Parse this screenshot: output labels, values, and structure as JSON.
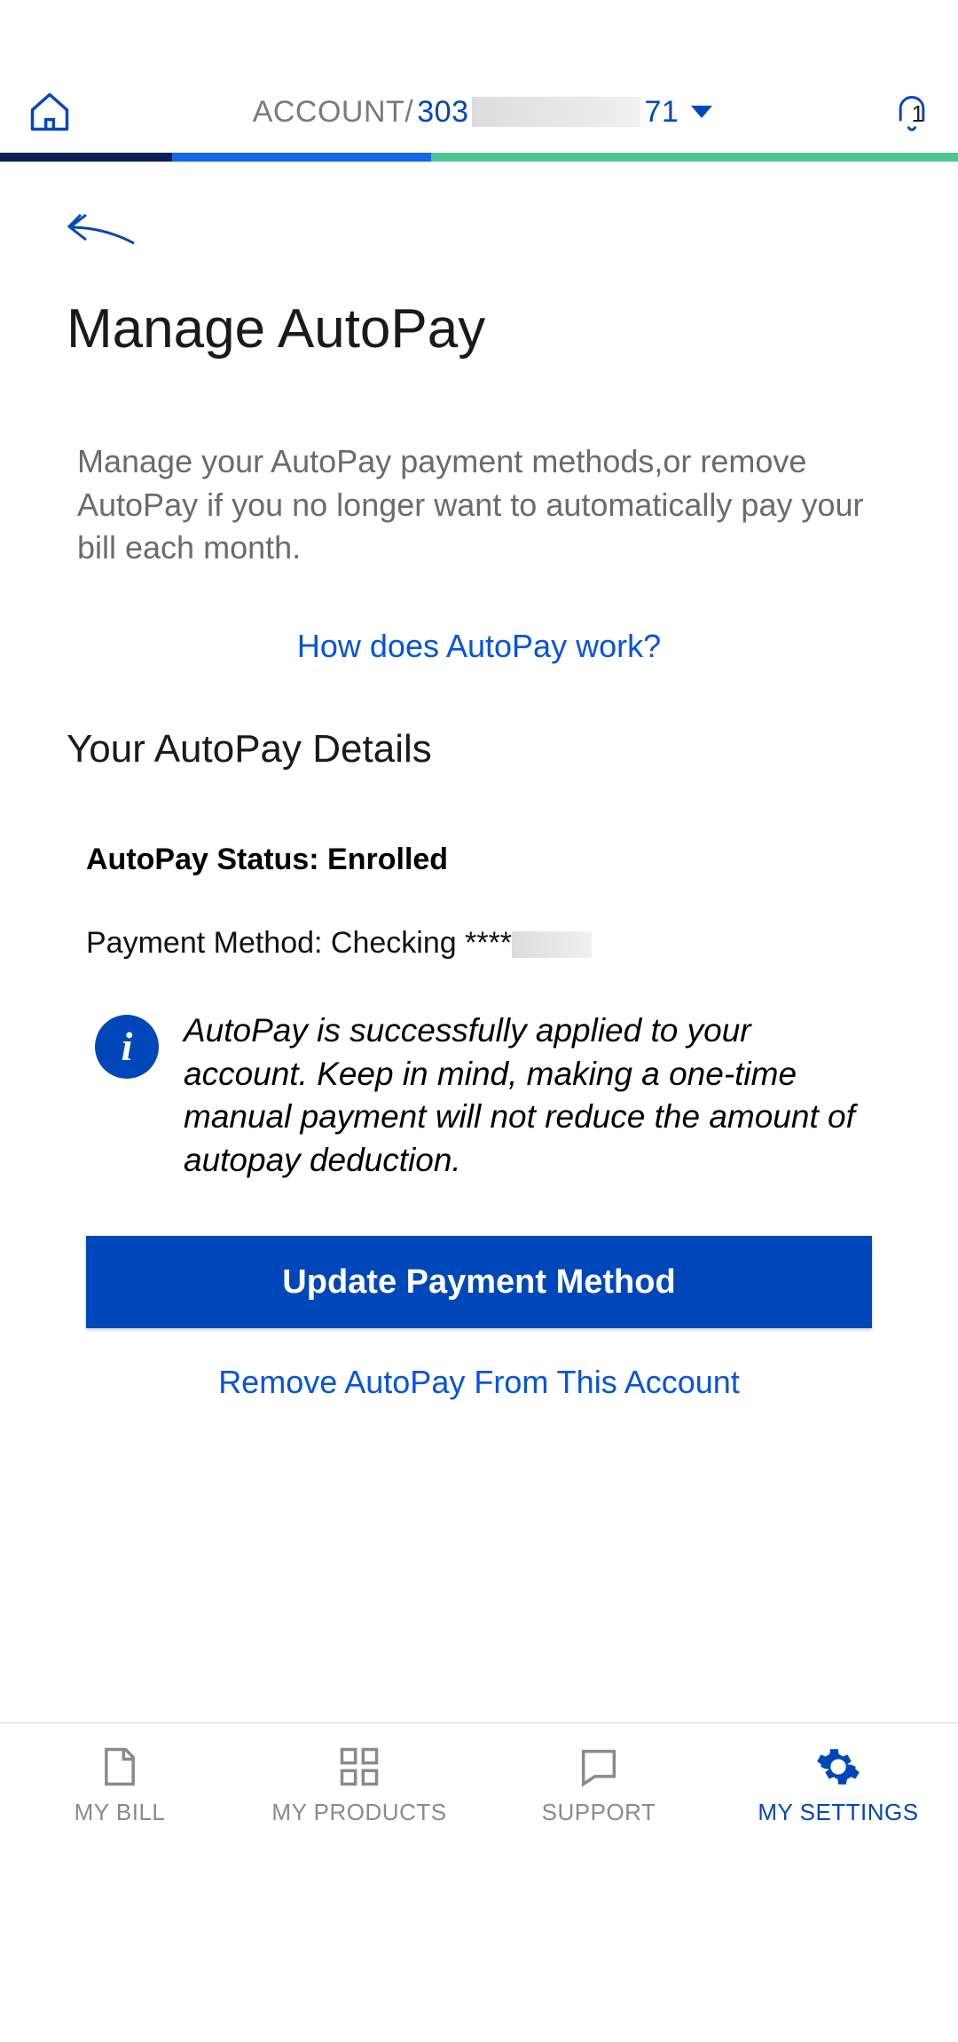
{
  "header": {
    "account_label": "ACCOUNT/",
    "account_number_prefix": "303",
    "account_number_suffix": "71",
    "notification_count": "1"
  },
  "page": {
    "title": "Manage AutoPay",
    "intro": "Manage your AutoPay payment methods,or remove AutoPay if you no longer want to automatically pay your bill each month.",
    "how_link": "How does AutoPay work?",
    "section_title": "Your AutoPay Details"
  },
  "details": {
    "status_label": "AutoPay Status: ",
    "status_value": "Enrolled",
    "method_label": "Payment Method: ",
    "method_value": "Checking ****",
    "info_text": "AutoPay is successfully applied to your account. Keep in mind, making a one-time manual payment will not reduce the amount of autopay deduction.",
    "update_btn": "Update Payment Method",
    "remove_link": "Remove AutoPay From This Account"
  },
  "nav": {
    "bill": "MY BILL",
    "products": "MY PRODUCTS",
    "support": "SUPPORT",
    "settings": "MY SETTINGS"
  }
}
